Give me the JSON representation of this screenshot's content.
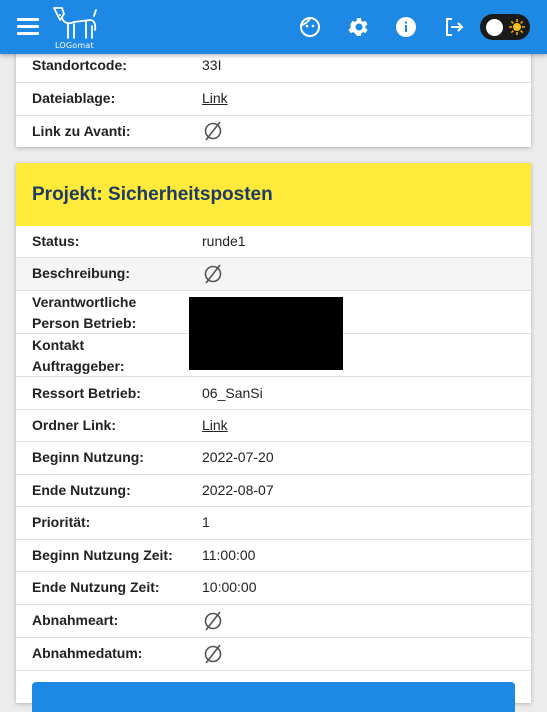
{
  "app": {
    "logo_text": "LOGomat"
  },
  "toolbar": {
    "icons": [
      "menu-icon",
      "face-icon",
      "gear-icon",
      "info-icon",
      "logout-icon"
    ],
    "theme_toggle": "sun-icon"
  },
  "card1": {
    "rows": [
      {
        "label": "Standortcode:",
        "value": "33I"
      },
      {
        "label": "Dateiablage:",
        "value": "Link"
      },
      {
        "label": "Link zu Avanti:",
        "value": "∅"
      }
    ]
  },
  "project": {
    "title": "Projekt: Sicherheitsposten",
    "rows": [
      {
        "label": "Status:",
        "value": "runde1"
      },
      {
        "label": "Beschreibung:",
        "value": "∅"
      },
      {
        "label": "Verantwortliche Person Betrieb:",
        "value": ""
      },
      {
        "label": "Kontakt Auftraggeber:",
        "value": ""
      },
      {
        "label": "Ressort Betrieb:",
        "value": "06_SanSi"
      },
      {
        "label": "Ordner Link:",
        "value": "Link"
      },
      {
        "label": "Beginn Nutzung:",
        "value": "2022-07-20"
      },
      {
        "label": "Ende Nutzung:",
        "value": "2022-08-07"
      },
      {
        "label": "Priorität:",
        "value": "1"
      },
      {
        "label": "Beginn Nutzung Zeit:",
        "value": "11:00:00"
      },
      {
        "label": "Ende Nutzung Zeit:",
        "value": "10:00:00"
      },
      {
        "label": "Abnahmeart:",
        "value": "∅"
      },
      {
        "label": "Abnahmedatum:",
        "value": "∅"
      }
    ]
  },
  "colors": {
    "appbar": "#1e88e5",
    "header": "#fdea3b",
    "title": "#1f3a63"
  }
}
